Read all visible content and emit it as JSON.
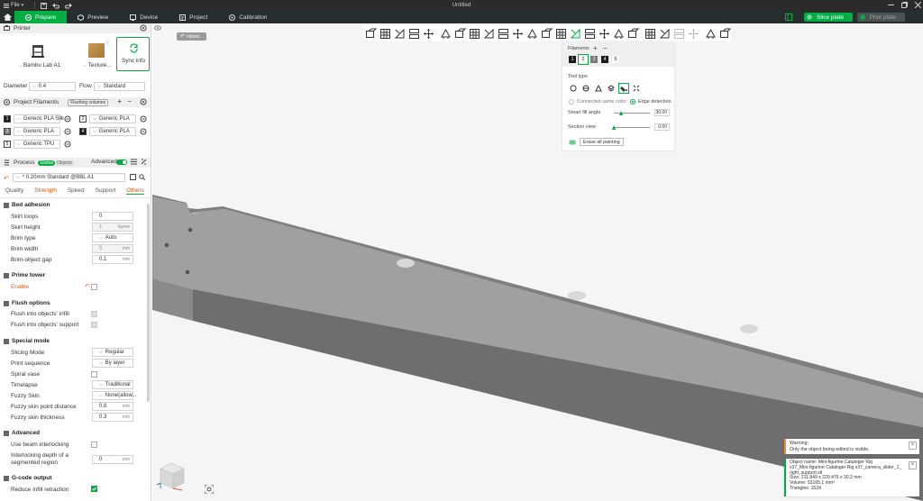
{
  "window": {
    "title": "Untitled",
    "file_menu": "File"
  },
  "nav": {
    "tabs": [
      {
        "label": "Prepare"
      },
      {
        "label": "Preview"
      },
      {
        "label": "Device"
      },
      {
        "label": "Project"
      },
      {
        "label": "Calibration"
      }
    ],
    "slice_label": "Slice plate",
    "print_label": "Print plate"
  },
  "printer": {
    "section_title": "Printer",
    "printer_name": "Bambu Lab A1",
    "plate_label": "Texture...",
    "sync_label": "Sync info",
    "diameter_label": "Diameter",
    "diameter_value": "0.4",
    "flow_label": "Flow",
    "flow_value": "Standard"
  },
  "filaments": {
    "section_title": "Project Filaments",
    "flushing_label": "Flushing volumes",
    "items": [
      {
        "num": "1",
        "name": "Generic PLA Silk",
        "color": "#1a1a1a"
      },
      {
        "num": "2",
        "name": "Generic PLA",
        "color": "#ffffff"
      },
      {
        "num": "3",
        "name": "Generic PLA",
        "color": "#7a7a7a"
      },
      {
        "num": "4",
        "name": "Generic PLA",
        "color": "#1a1a1a"
      },
      {
        "num": "5",
        "name": "Generic TPU",
        "color": "#ffffff"
      }
    ]
  },
  "process": {
    "section_title": "Process",
    "global_label": "Global",
    "objects_label": "Objects",
    "advanced_label": "Advanced",
    "profile": "* 0.20mm Standard @BBL A1",
    "tabs": [
      "Quality",
      "Strength",
      "Speed",
      "Support",
      "Others"
    ]
  },
  "settings": {
    "bed_adhesion": "Bed adhesion",
    "skirt_loops_label": "Skirt loops",
    "skirt_loops": "0",
    "skirt_height_label": "Skirt height",
    "skirt_height": "1",
    "skirt_height_unit": "layers",
    "brim_type_label": "Brim type",
    "brim_type": "Auto",
    "brim_width_label": "Brim width",
    "brim_width": "5",
    "mm": "mm",
    "brim_gap_label": "Brim-object gap",
    "brim_gap": "0.1",
    "prime_tower": "Prime tower",
    "enable_label": "Enable",
    "flush_options": "Flush options",
    "flush_infill_label": "Flush into objects' infill",
    "flush_support_label": "Flush into objects' support",
    "special_mode": "Special mode",
    "slicing_mode_label": "Slicing Mode",
    "slicing_mode": "Regular",
    "print_sequence_label": "Print sequence",
    "print_sequence": "By layer",
    "spiral_vase_label": "Spiral vase",
    "timelapse_label": "Timelapse",
    "timelapse": "Traditional",
    "fuzzy_skin_label": "Fuzzy Skin",
    "fuzzy_skin": "None(allow...",
    "fuzzy_dist_label": "Fuzzy skin point distance",
    "fuzzy_dist": "0.8",
    "fuzzy_thick_label": "Fuzzy skin thickness",
    "fuzzy_thick": "0.3",
    "advanced": "Advanced",
    "beam_label": "Use beam interlocking",
    "interlock_label_1": "Interlocking depth of a",
    "interlock_label_2": "segmented region",
    "interlock_value": "0",
    "gcode_output": "G-code output",
    "reduce_retract_label": "Reduce infill retraction"
  },
  "viewport": {
    "return_label": "return"
  },
  "paint": {
    "filaments_title": "Filaments",
    "filament_nums": [
      "1",
      "2",
      "3",
      "4",
      "5"
    ],
    "tool_type_label": "Tool type",
    "connected_label": "Connected same color",
    "edge_label": "Edge detection",
    "smart_fill_label": "Smart fill angle",
    "smart_fill_value": "30.00",
    "smart_fill_fraction": 0.22,
    "section_view_label": "Section view",
    "section_value": "0.00",
    "section_fraction": 0.0,
    "erase_label": "Erase all painting"
  },
  "notifications": {
    "warn_title": "Warning:",
    "warn_text": "Only the object being edited is visible.",
    "info_lines": [
      "Object name: Mini-figurine Cataloger Rig",
      "v37_Mini-figurine Cataloger Rig v37_camera_slider_1_",
      "right_support.stl",
      "Size: 211.849 x 220.476 x 30.2 mm",
      "Volume: 53165.1 mm³",
      "Triangles: 1524"
    ]
  },
  "colors": {
    "accent": "#00ae42",
    "nav_bg": "#262e2e",
    "title_bg": "#2b2b2b",
    "warn": "#f08c3a"
  }
}
